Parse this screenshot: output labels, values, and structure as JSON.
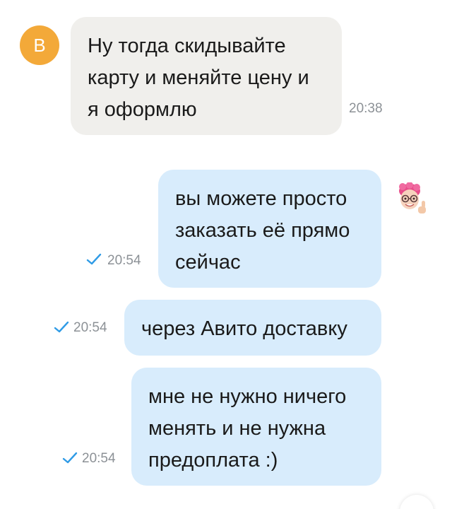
{
  "chat": {
    "incoming": {
      "avatar_letter": "В",
      "avatar_color": "#f3a939",
      "text": "Ну тогда скидывайте\nкарту и меняйте цену и\nя оформлю",
      "time": "20:38"
    },
    "outgoing": [
      {
        "text": "вы можете просто\nзаказать её прямо\nсейчас",
        "time": "20:54",
        "status": "sent"
      },
      {
        "text": "через Авито доставку",
        "time": "20:54",
        "status": "sent"
      },
      {
        "text": "мне не нужно ничего\nменять и не нужна\nпредоплата :)",
        "time": "20:54",
        "status": "sent"
      }
    ],
    "colors": {
      "incoming_bubble": "#f0efec",
      "outgoing_bubble": "#d8ecfc",
      "check": "#2f9be6",
      "time_text": "#8c9196"
    },
    "sender_avatar_icon": "memoji-thumbs-up-icon"
  }
}
